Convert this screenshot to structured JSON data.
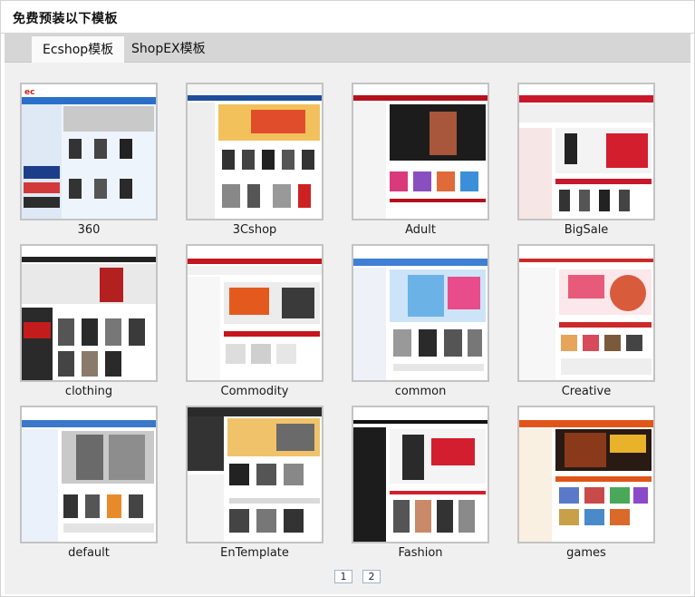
{
  "header": {
    "title": "免费预装以下模板"
  },
  "tabs": [
    {
      "label": "Ecshop模板",
      "active": true
    },
    {
      "label": "ShopEX模板",
      "active": false
    }
  ],
  "templates": [
    {
      "name": "360",
      "icon": "template-thumbnail"
    },
    {
      "name": "3Cshop",
      "icon": "template-thumbnail"
    },
    {
      "name": "Adult",
      "icon": "template-thumbnail"
    },
    {
      "name": "BigSale",
      "icon": "template-thumbnail"
    },
    {
      "name": "clothing",
      "icon": "template-thumbnail"
    },
    {
      "name": "Commodity",
      "icon": "template-thumbnail"
    },
    {
      "name": "common",
      "icon": "template-thumbnail"
    },
    {
      "name": "Creative",
      "icon": "template-thumbnail"
    },
    {
      "name": "default",
      "icon": "template-thumbnail"
    },
    {
      "name": "EnTemplate",
      "icon": "template-thumbnail"
    },
    {
      "name": "Fashion",
      "icon": "template-thumbnail"
    },
    {
      "name": "games",
      "icon": "template-thumbnail"
    }
  ],
  "pagination": {
    "pages": [
      "1",
      "2"
    ],
    "current": "1"
  },
  "colors": {
    "tab_strip": "#d6d6d6",
    "content_bg": "#f0f0f0",
    "thumb_border": "#c3c3c3"
  }
}
